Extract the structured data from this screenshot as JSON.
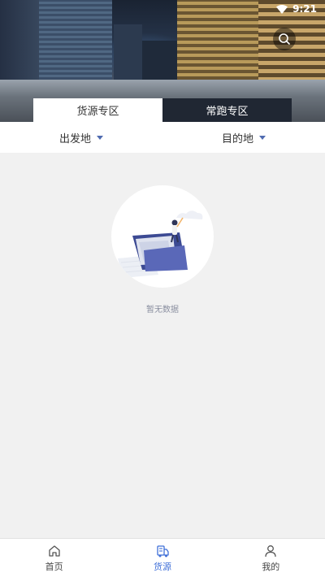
{
  "status_bar": {
    "time": "9:21",
    "wifi_icon": "wifi-icon"
  },
  "hero": {
    "search_icon": "search-icon"
  },
  "tabs": [
    {
      "label": "货源专区",
      "active": true
    },
    {
      "label": "常跑专区",
      "active": false
    }
  ],
  "filters": {
    "origin_label": "出发地",
    "destination_label": "目的地",
    "caret_icon": "caret-down-icon",
    "caret_color": "#4f6bb0"
  },
  "empty_state": {
    "message": "暂无数据",
    "illustration_icon": "empty-folder-illustration"
  },
  "bottom_nav": [
    {
      "label": "首页",
      "icon": "home-icon",
      "active": false
    },
    {
      "label": "货源",
      "icon": "truck-icon",
      "active": true
    },
    {
      "label": "我的",
      "icon": "user-icon",
      "active": false
    }
  ],
  "colors": {
    "accent": "#3f6fd8",
    "tab_inactive_bg": "#202733"
  }
}
